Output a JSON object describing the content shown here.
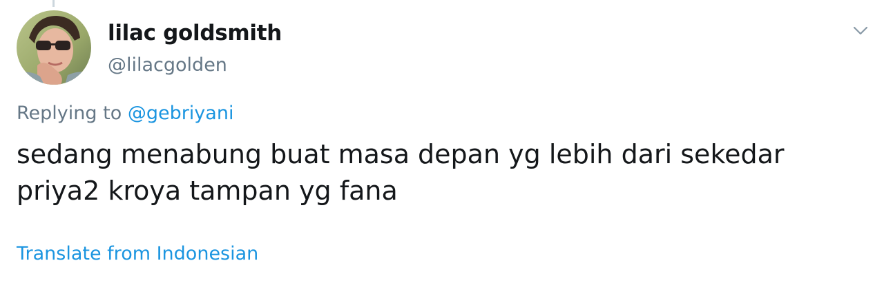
{
  "tweet": {
    "author": {
      "display_name": "lilac goldsmith",
      "handle": "@lilacgolden",
      "avatar_icon": "profile-photo"
    },
    "reply_context": {
      "prefix": "Replying to",
      "mention": "@gebriyani"
    },
    "text": "sedang menabung buat masa depan yg lebih dari sekedar priya2 kroya tampan yg fana",
    "translate_label": "Translate from Indonesian",
    "menu_icon": "chevron-down-icon"
  },
  "colors": {
    "primary_text": "#14171a",
    "secondary_text": "#657786",
    "link": "#1b95e0",
    "thread_line": "#ccd6dd"
  }
}
